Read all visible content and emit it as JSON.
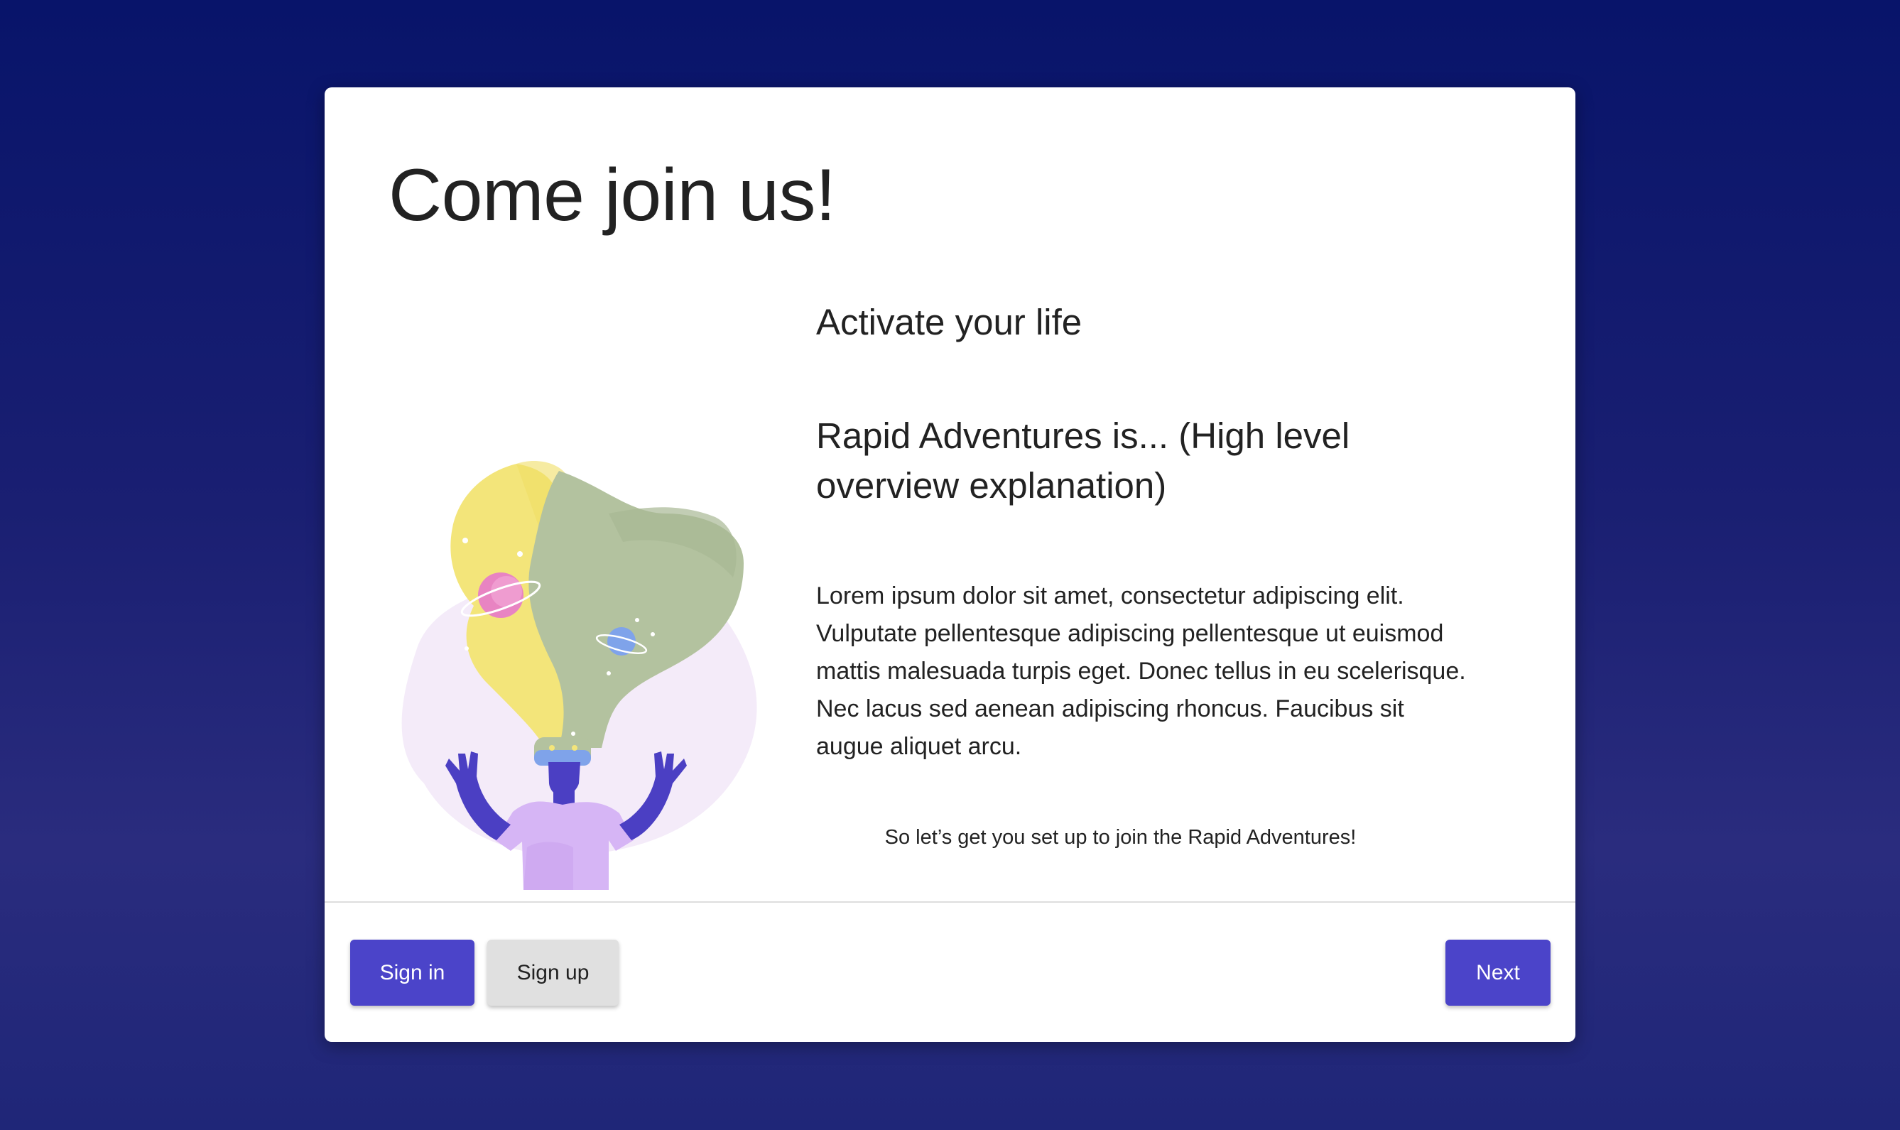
{
  "dialog": {
    "title": "Come join us!",
    "subtitle": "Activate your life",
    "overview": "Rapid Adventures is... (High level overview explanation)",
    "body": "Lorem ipsum dolor sit amet, consectetur adipiscing elit. Vulputate pellentesque adipiscing pellentesque ut euismod mattis malesuada turpis eget. Donec tellus in eu scelerisque. Nec lacus sed aenean adipiscing rhoncus. Faucibus sit augue aliquet arcu.",
    "setup_text": "So let’s get you set up to join the Rapid Adventures!"
  },
  "footer": {
    "sign_in_label": "Sign in",
    "sign_up_label": "Sign up",
    "next_label": "Next"
  },
  "colors": {
    "background_top": "#08146a",
    "background_bottom": "#2a2c7e",
    "primary_button": "#4b44c9",
    "secondary_button": "#e0e0e0",
    "illustration_yellow": "#f3e57a",
    "illustration_green": "#b3c29f",
    "illustration_lavender": "#f3eaf8",
    "illustration_figure": "#4b3fc3",
    "illustration_shirt": "#d6b5f5"
  },
  "illustration": {
    "icon": "vr-headset-person-illustration"
  }
}
